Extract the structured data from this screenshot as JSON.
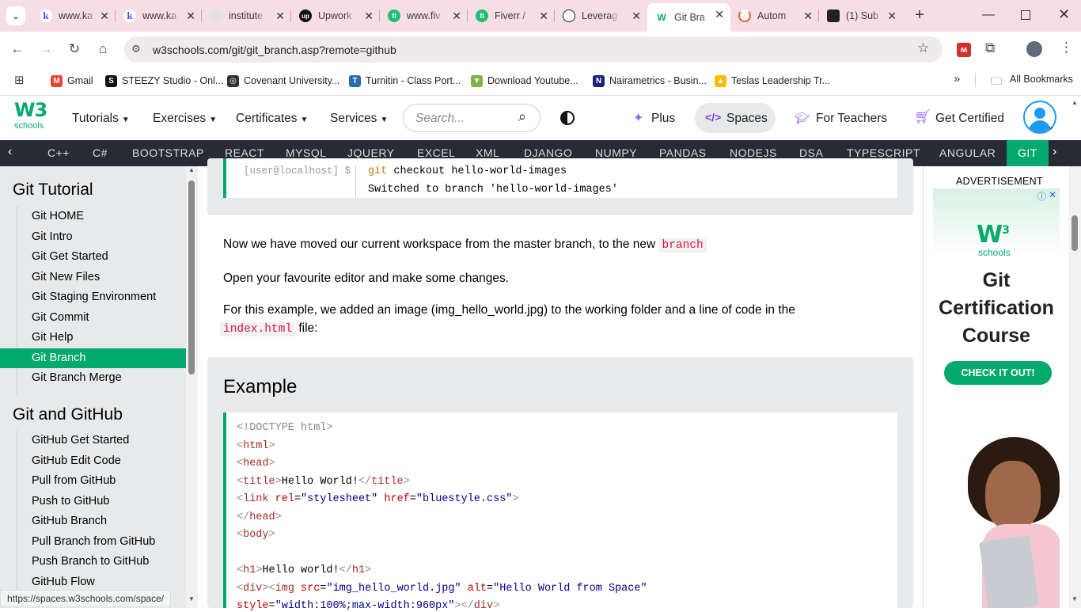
{
  "tabs": [
    {
      "title": "www.ka",
      "icon": "k"
    },
    {
      "title": "www.ka",
      "icon": "k"
    },
    {
      "title": "institute",
      "icon": "link"
    },
    {
      "title": "Upwork",
      "icon": "up"
    },
    {
      "title": "www.fiv",
      "icon": "fi"
    },
    {
      "title": "Fiverr /",
      "icon": "fi"
    },
    {
      "title": "Leverag",
      "icon": "gpt"
    },
    {
      "title": "Git Bra",
      "icon": "W",
      "active": true
    },
    {
      "title": "Autom",
      "icon": "ring"
    },
    {
      "title": "(1) Sub",
      "icon": "yt"
    }
  ],
  "browser": {
    "url": "w3schools.com/git/git_branch.asp?remote=github",
    "all_bookmarks": "All Bookmarks",
    "status_url": "https://spaces.w3schools.com/space/"
  },
  "bookmarks": [
    {
      "label": "Gmail",
      "color": "#ea4335",
      "glyph": "M"
    },
    {
      "label": "STEEZY Studio - Onl...",
      "color": "#111111",
      "glyph": "S"
    },
    {
      "label": "Covenant University...",
      "color": "#333333",
      "glyph": "◎"
    },
    {
      "label": "Turnitin - Class Port...",
      "color": "#2b6cb0",
      "glyph": "T"
    },
    {
      "label": "Download Youtube...",
      "color": "#7cb342",
      "glyph": "▼"
    },
    {
      "label": "Nairametrics - Busin...",
      "color": "#1a237e",
      "glyph": "N"
    },
    {
      "label": "Teslas Leadership Tr...",
      "color": "#fbbc04",
      "glyph": "▲"
    }
  ],
  "w3nav": {
    "logo_top": "W3",
    "logo_sub": "schools",
    "menus": [
      "Tutorials",
      "Exercises",
      "Certificates",
      "Services"
    ],
    "search_placeholder": "Search...",
    "plus": "Plus",
    "spaces": "Spaces",
    "teachers": "For Teachers",
    "certified": "Get Certified"
  },
  "topnav": [
    "C++",
    "C#",
    "BOOTSTRAP",
    "REACT",
    "MYSQL",
    "JQUERY",
    "EXCEL",
    "XML",
    "DJANGO",
    "NUMPY",
    "PANDAS",
    "NODEJS",
    "DSA",
    "TYPESCRIPT",
    "ANGULAR",
    "GIT"
  ],
  "sidebar": {
    "heading1": "Git Tutorial",
    "items1": [
      "Git HOME",
      "Git Intro",
      "Git Get Started",
      "Git New Files",
      "Git Staging Environment",
      "Git Commit",
      "Git Help",
      "Git Branch",
      "Git Branch Merge"
    ],
    "active_index": 7,
    "heading2": "Git and GitHub",
    "items2": [
      "GitHub Get Started",
      "GitHub Edit Code",
      "Pull from GitHub",
      "Push to GitHub",
      "GitHub Branch",
      "Pull Branch from GitHub",
      "Push Branch to GitHub",
      "GitHub Flow"
    ]
  },
  "terminal": {
    "prompt": "[user@localhost] $",
    "command": "git checkout hello-world-images",
    "output": "Switched to branch 'hello-world-images'"
  },
  "content": {
    "p1_text": "Now we have moved our current workspace from the master branch, to the new",
    "p1_code": "branch",
    "p2": "Open your favourite editor and make some changes.",
    "p3a": "For this example, we added an image (img_hello_world.jpg) to the working folder and a line of code in the",
    "p3_code": "index.html",
    "p3b": "file:",
    "example_heading": "Example"
  },
  "ad": {
    "label": "ADVERTISEMENT",
    "logo_sub": "schools",
    "title_lines": [
      "Git",
      "Certification",
      "Course"
    ],
    "button": "CHECK IT OUT!"
  }
}
